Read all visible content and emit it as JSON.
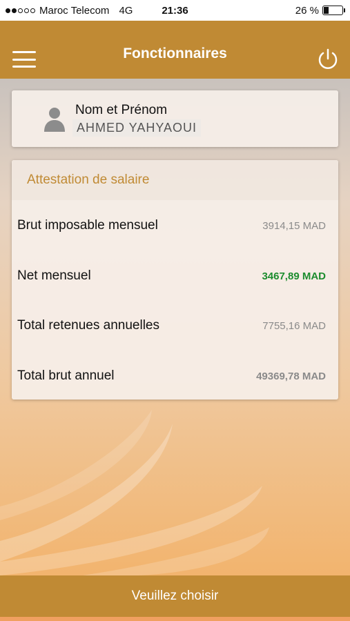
{
  "status_bar": {
    "carrier": "Maroc Telecom",
    "network": "4G",
    "time": "21:36",
    "battery": "26 %",
    "battery_level": 0.26
  },
  "header": {
    "title": "Fonctionnaires",
    "menu_icon": "hamburger-menu-icon",
    "power_icon": "power-icon"
  },
  "profile": {
    "label": "Nom et Prénom",
    "value": "AHMED YAHYAOUI",
    "icon": "user-avatar-icon"
  },
  "salary": {
    "title": "Attestation de salaire",
    "rows": [
      {
        "label": "Brut imposable mensuel",
        "value": "3914,15 MAD"
      },
      {
        "label": "Net mensuel",
        "value": "3467,89 MAD"
      },
      {
        "label": "Total retenues annuelles",
        "value": "7755,16 MAD"
      },
      {
        "label": "Total brut annuel",
        "value": "49369,78 MAD"
      }
    ]
  },
  "bottom": {
    "label": "Veuillez choisir"
  },
  "colors": {
    "accent": "#c08a34",
    "net_value": "#1c8c2e"
  }
}
